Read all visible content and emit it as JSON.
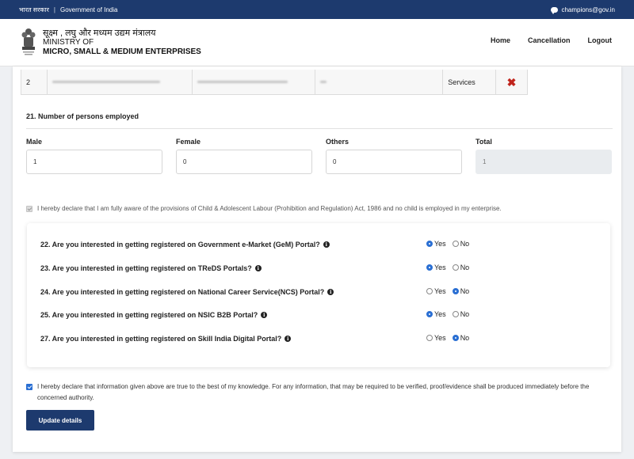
{
  "topbar": {
    "hindi": "भारत सरकार",
    "separator": "|",
    "govt": "Government of India",
    "email": "champions@gov.in",
    "icon": "chat-icon"
  },
  "header": {
    "ministry_hindi": "सूक्ष्म , लघु और मध्यम उद्यम मंत्रालय",
    "ministry_line1": "MINISTRY OF",
    "ministry_line2": "MICRO, SMALL & MEDIUM ENTERPRISES",
    "logo": "national-emblem",
    "nav": [
      "Home",
      "Cancellation",
      "Logout"
    ]
  },
  "unit_table": {
    "row": {
      "sno": "2",
      "type": "Services",
      "delete_icon": "delete-x-icon"
    }
  },
  "employment": {
    "title": "21. Number of persons employed",
    "fields": [
      {
        "label": "Male",
        "value": "1"
      },
      {
        "label": "Female",
        "value": "0"
      },
      {
        "label": "Others",
        "value": "0"
      },
      {
        "label": "Total",
        "value": "1"
      }
    ]
  },
  "declaration_child_labour": "I hereby declare that I am fully aware of the provisions of Child & Adolescent Labour (Prohibition and Regulation) Act, 1986 and no child is employed in my enterprise.",
  "questions": [
    {
      "text": "22. Are you interested in getting registered on Government e-Market (GeM) Portal?",
      "selected": "Yes"
    },
    {
      "text": "23. Are you interested in getting registered on TReDS Portals?",
      "selected": "Yes"
    },
    {
      "text": "24. Are you interested in getting registered on National Career Service(NCS) Portal?",
      "selected": "No"
    },
    {
      "text": "25. Are you interested in getting registered on NSIC B2B Portal?",
      "selected": "Yes"
    },
    {
      "text": "27. Are you interested in getting registered on Skill India Digital Portal?",
      "selected": "No"
    }
  ],
  "options": {
    "yes": "Yes",
    "no": "No"
  },
  "declaration_final": "I hereby declare that information given above are true to the best of my knowledge. For any information, that may be required to be verified, proof/evidence shall be produced immediately before the concerned authority.",
  "submit_label": "Update details",
  "colors": {
    "primary": "#1d3a6e",
    "radio_selected": "#2a6fd3",
    "delete": "#c0241c"
  }
}
